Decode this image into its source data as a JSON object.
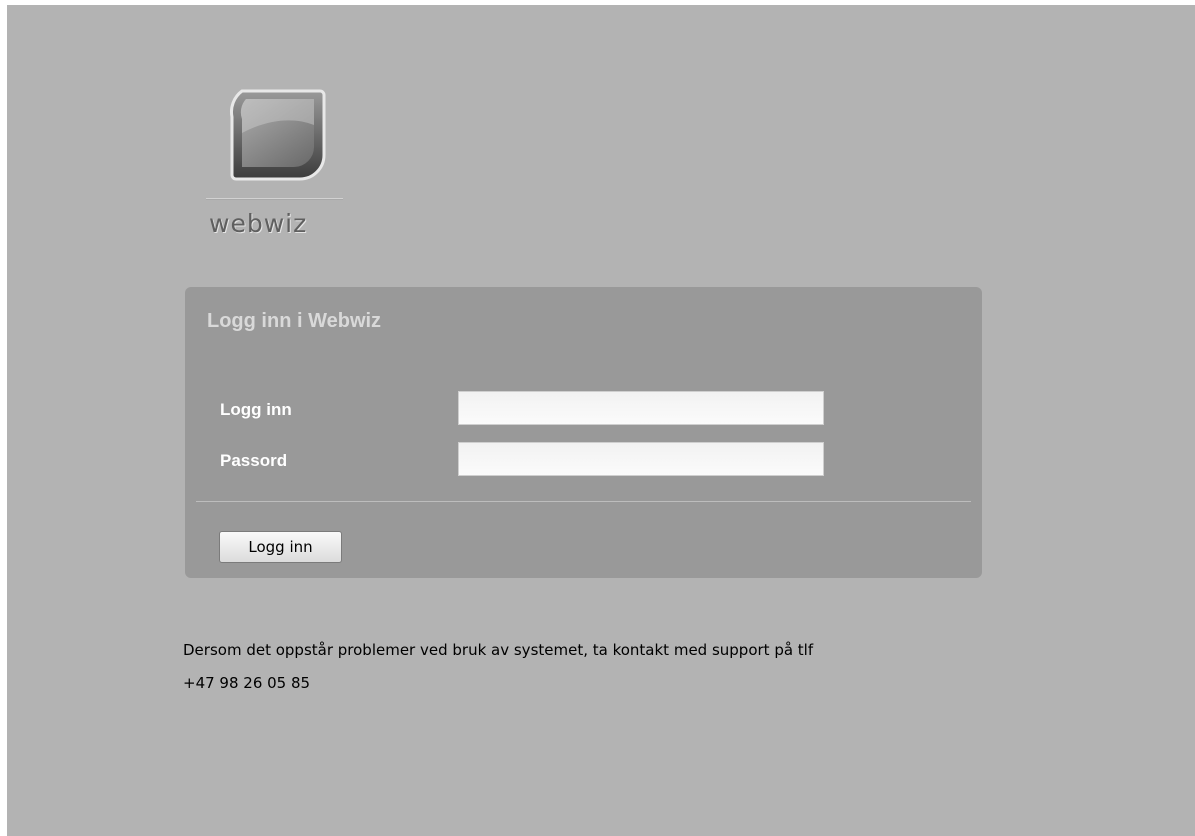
{
  "logo": {
    "text": "webwiz",
    "icon": "speech-bubble-logo-icon"
  },
  "login": {
    "title": "Logg inn i Webwiz",
    "username_label": "Logg inn",
    "username_value": "",
    "password_label": "Passord",
    "password_value": "",
    "button_label": "Logg inn"
  },
  "support": {
    "line1": "Dersom det oppstår problemer ved bruk av systemet, ta kontakt med support på tlf",
    "line2": "+47 98 26 05 85"
  },
  "colors": {
    "background": "#b3b3b3",
    "box": "#999999",
    "label": "#ffffff",
    "title": "#d9d9d9"
  }
}
